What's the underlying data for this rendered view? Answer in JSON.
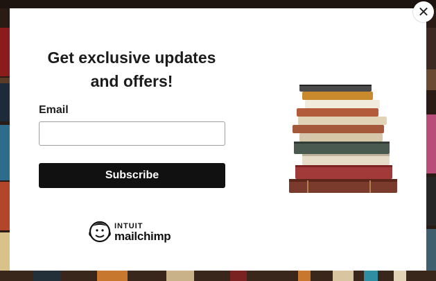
{
  "popup": {
    "headline": "Get exclusive updates and offers!",
    "email_label": "Email",
    "email_value": "",
    "email_placeholder": "",
    "subscribe_label": "Subscribe",
    "brand_line1": "INTUIT",
    "brand_line2": "mailchimp",
    "close_symbol": "✕",
    "image_icon": "stacked-books-illustration",
    "brand_icon": "mailchimp-freddie-logo"
  },
  "colors": {
    "button_bg": "#111111",
    "button_text": "#ffffff",
    "modal_bg": "#ffffff",
    "text": "#1b1b1b"
  }
}
